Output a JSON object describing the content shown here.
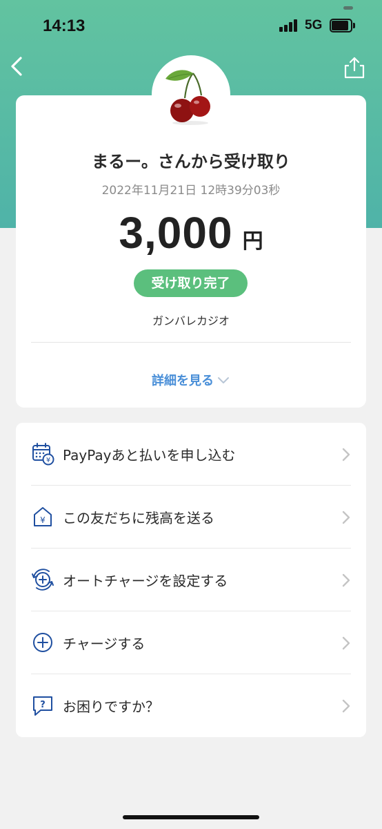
{
  "status_bar": {
    "time": "14:13",
    "network": "5G",
    "icons": [
      "signal-icon",
      "battery-icon"
    ]
  },
  "nav": {
    "back_icon": "chevron-left-icon",
    "share_icon": "share-icon"
  },
  "theme": {
    "header_gradient": [
      "#62c3a0",
      "#4fb3a8"
    ],
    "badge_color": "#5bbf7d",
    "link_color": "#4a8fd8",
    "icon_color": "#1f4fa0"
  },
  "transaction": {
    "avatar_icon": "cherry-icon",
    "title": "まるー。さんから受け取り",
    "datetime": "2022年11月21日 12時39分03秒",
    "amount": "3,000",
    "currency": "円",
    "status": "受け取り完了",
    "message": "ガンバレカジオ",
    "details_link": "詳細を見る"
  },
  "menu": {
    "items": [
      {
        "label": "PayPayあと払いを申し込む",
        "icon": "calendar-yen-icon"
      },
      {
        "label": "この友だちに残高を送る",
        "icon": "house-yen-icon"
      },
      {
        "label": "オートチャージを設定する",
        "icon": "auto-charge-icon"
      },
      {
        "label": "チャージする",
        "icon": "plus-circle-icon"
      },
      {
        "label": "お困りですか？",
        "icon": "help-chat-icon"
      }
    ]
  }
}
